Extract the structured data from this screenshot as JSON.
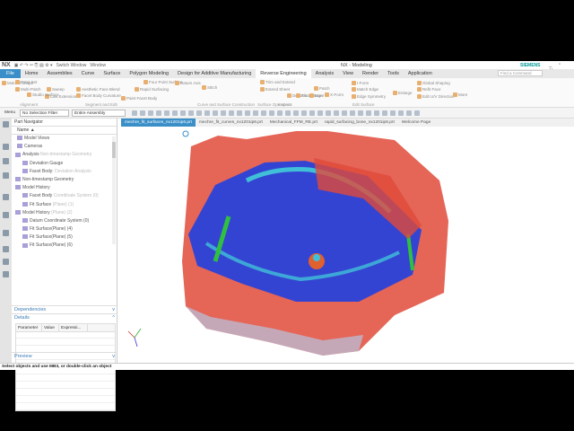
{
  "app": {
    "logo": "NX",
    "title": "NX - Modeling",
    "brand": "SIEMENS",
    "switch_window": "Switch Window",
    "window_menu": "Window"
  },
  "tabs": [
    "File",
    "Home",
    "Assemblies",
    "Curve",
    "Surface",
    "Polygon Modeling",
    "Design for Additive Manufacturing",
    "Reverse Engineering",
    "Analysis",
    "View",
    "Render",
    "Tools",
    "Application"
  ],
  "find_placeholder": "Find a Command",
  "ribbon": {
    "commands": [
      "Molded Shape",
      "Point Set",
      "Multi-Patch",
      "Sweep",
      "Law Extension",
      "Studio Surface",
      "Aesthetic Face Blend",
      "Facet Body Curvature",
      "Rapid Surfacing",
      "Four Point Surface",
      "Datum Axis",
      "Paint Facet Body",
      "Stitch",
      "Trim and Extend",
      "Extend Sheet",
      "Deviation Gauge",
      "Patch",
      "Thicken",
      "More",
      "X-Form",
      "I-Form",
      "Match Edge",
      "Edge Symmetry",
      "Enlarge",
      "Global Shaping",
      "Refit Face",
      "Edit U/V Direction",
      "More"
    ],
    "groups": [
      "Alignment",
      "Segment and Edit",
      "Curve and Surface Construction",
      "Surface Operations",
      "Inspect",
      "Edit Surface"
    ]
  },
  "toolbar": {
    "menu": "Menu",
    "filter": "No Selection Filter",
    "assembly": "Entire Assembly"
  },
  "navigator": {
    "title": "Part Navigator",
    "column": "Name",
    "items": [
      {
        "label": "Model Views",
        "ghost": ""
      },
      {
        "label": "Cameras",
        "ghost": ""
      },
      {
        "label": "Analysis",
        "ghost": "Non-timestamp Geometry"
      },
      {
        "label": "Deviation Gauge",
        "ghost": ""
      },
      {
        "label": "Facet Body:",
        "ghost": "Deviation Analysis"
      },
      {
        "label": "Non-timestamp Geometry",
        "ghost": ""
      },
      {
        "label": "Model History",
        "ghost": ""
      },
      {
        "label": "Facet Body",
        "ghost": "Coordinate System (0)"
      },
      {
        "label": "Fit Surface",
        "ghost": "(Plane) (1)"
      },
      {
        "label": "Model History",
        "ghost": "(Plane) (2)"
      },
      {
        "label": "Datum Coordinate System (0)",
        "ghost": ""
      },
      {
        "label": "Fit Surface(Plane) (4)",
        "ghost": ""
      },
      {
        "label": "Fit Surface(Plane) (5)",
        "ghost": ""
      },
      {
        "label": "Fit Surface(Plane) (6)",
        "ghost": ""
      }
    ],
    "dependencies": "Dependencies",
    "details": "Details",
    "preview": "Preview",
    "detail_columns": [
      "Parameter",
      "Value",
      "Expressi..."
    ]
  },
  "file_tabs": [
    "mechre_fit_surfaces_nx1201ip6.prt",
    "mechre_fit_curves_nx1201ip6.prt",
    "Mechanical_FFM_RE.prt",
    "rapid_surfacing_bone_nx1201ip6.prt",
    "Welcome Page"
  ],
  "status": "Select objects and use MB3, or double-click an object",
  "colors": {
    "accent": "#3a8fc8",
    "brand": "#009999",
    "model_red": "#e04a3a",
    "model_blue": "#2040e0"
  }
}
